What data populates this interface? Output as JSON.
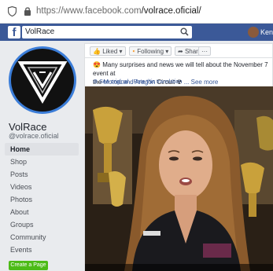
{
  "browser": {
    "url_host": "https://www.facebook.com",
    "url_path": "/volrace.oficial/"
  },
  "fb_header": {
    "logo": "f",
    "search_value": "VolRace",
    "profile_name": "Kens"
  },
  "page_profile": {
    "name": "VolRace",
    "handle": "@volrace.oficial"
  },
  "sidebar": {
    "items": [
      {
        "label": "Home",
        "active": true
      },
      {
        "label": "Shop"
      },
      {
        "label": "Posts"
      },
      {
        "label": "Videos"
      },
      {
        "label": "Photos"
      },
      {
        "label": "About"
      },
      {
        "label": "Groups"
      },
      {
        "label": "Community"
      },
      {
        "label": "Events"
      }
    ],
    "create_page": "Create a Page"
  },
  "actions": {
    "liked": "Liked ▾",
    "following": "Following ▾",
    "share": "Share",
    "more": "···"
  },
  "post": {
    "line1": "Many surprises and news we will tell about the November 7 event at",
    "line2_prefix": "the",
    "line2_link": "MotorLand Aragón",
    "line2_suffix": "Circuit",
    "see_more": "... See more",
    "see_original": "See original",
    "separator": "·",
    "rate": "Rate this translation"
  },
  "colors": {
    "fb_blue": "#3b5998",
    "link": "#385898",
    "create_green": "#4cbb17",
    "frame": "#ff00ff"
  }
}
